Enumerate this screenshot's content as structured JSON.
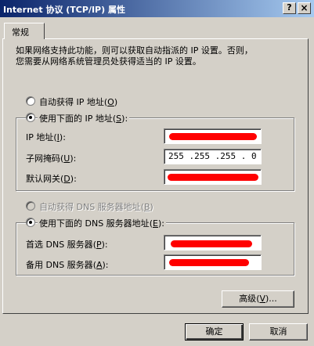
{
  "window": {
    "title": "Internet 协议 (TCP/IP) 属性",
    "help_label": "?",
    "close_label": "×"
  },
  "tabs": [
    {
      "label": "常规",
      "selected": true
    }
  ],
  "description": {
    "line1": "如果网络支持此功能，则可以获取自动指派的 IP 设置。否则，",
    "line2": "您需要从网络系统管理员处获得适当的 IP 设置。"
  },
  "ip": {
    "auto_label": "自动获得 IP 地址",
    "auto_accel": "O",
    "auto_selected": false,
    "manual_label": "使用下面的 IP 地址",
    "manual_accel": "S",
    "manual_selected": true,
    "address_label": "IP 地址",
    "address_accel": "I",
    "address_value": "",
    "subnet_label": "子网掩码",
    "subnet_accel": "U",
    "subnet_value": "255 .255 .255 . 0",
    "gateway_label": "默认网关",
    "gateway_accel": "D",
    "gateway_value": ""
  },
  "dns": {
    "auto_label": "自动获得 DNS 服务器地址",
    "auto_accel": "B",
    "auto_enabled": false,
    "manual_label": "使用下面的 DNS 服务器地址",
    "manual_accel": "E",
    "manual_selected": true,
    "preferred_label": "首选 DNS 服务器",
    "preferred_accel": "P",
    "preferred_value": "",
    "alternate_label": "备用 DNS 服务器",
    "alternate_accel": "A",
    "alternate_value": ""
  },
  "buttons": {
    "advanced": "高级",
    "advanced_accel": "V",
    "ok": "确定",
    "cancel": "取消"
  },
  "colors": {
    "titlebar_start": "#0a246a",
    "titlebar_end": "#a6caf0",
    "dialog_bg": "#d4d0c8",
    "redaction": "#ff0000"
  }
}
